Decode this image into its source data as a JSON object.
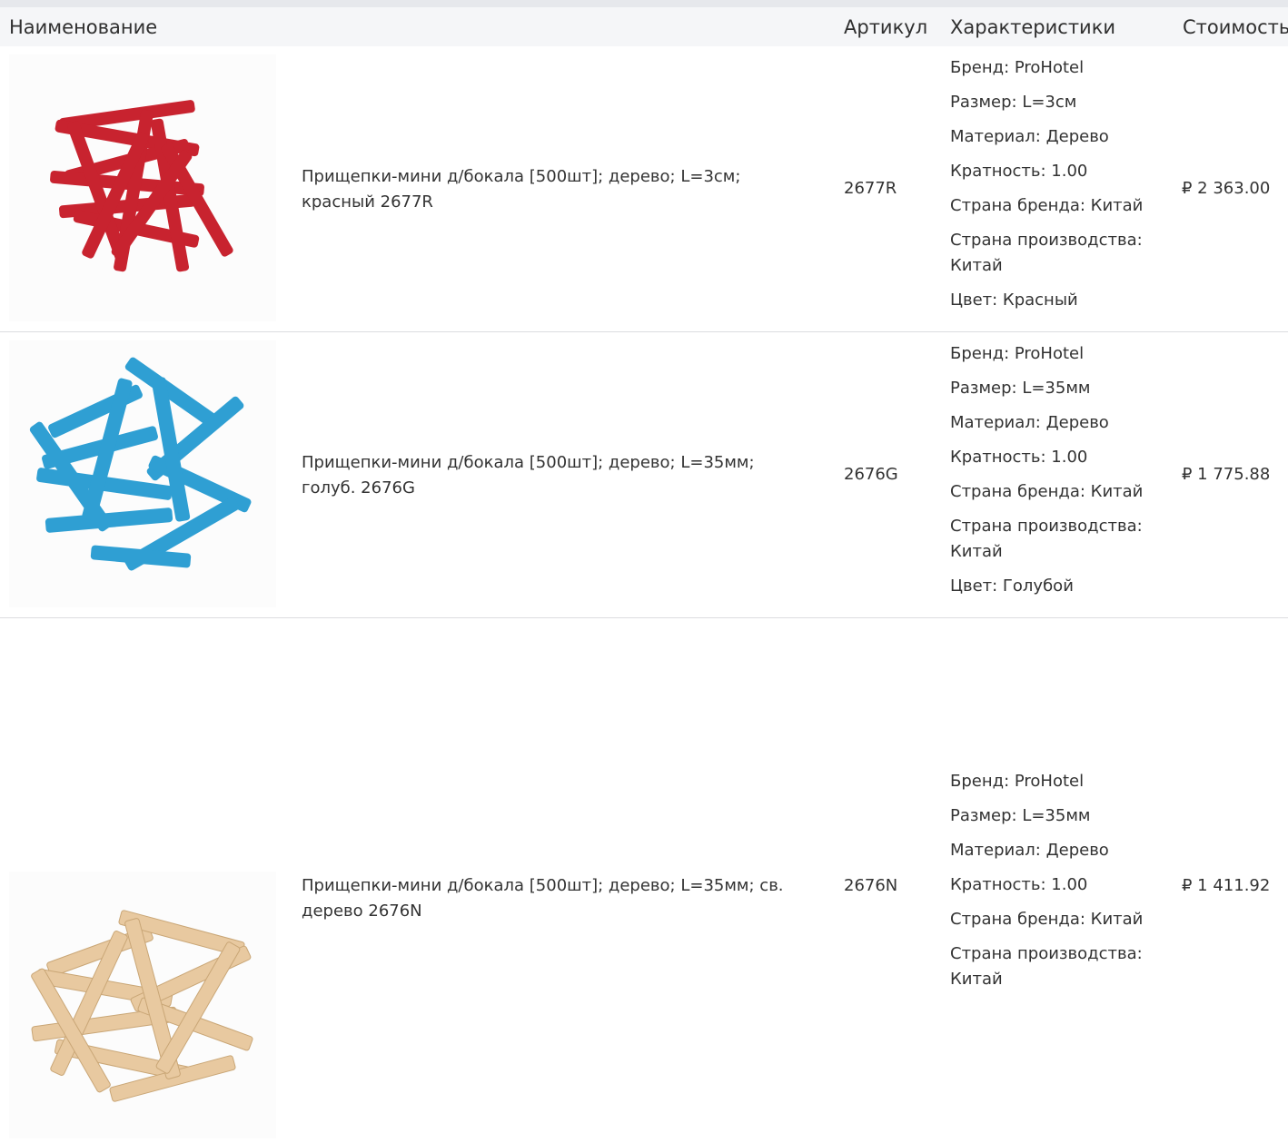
{
  "header": {
    "name": "Наименование",
    "sku": "Артикул",
    "specs": "Характеристики",
    "price": "Стоимость"
  },
  "products": [
    {
      "image_color": "#c8232f",
      "name": "Прищепки-мини д/бокала [500шт]; дерево; L=3см; красный 2677R",
      "sku": "2677R",
      "price": "₽ 2 363.00",
      "specs": [
        "Бренд: ProHotel",
        "Размер: L=3см",
        "Материал: Дерево",
        "Кратность: 1.00",
        "Страна бренда: Китай",
        "Страна производства: Китай",
        "Цвет: Красный"
      ]
    },
    {
      "image_color": "#2f9fd3",
      "name": "Прищепки-мини д/бокала [500шт]; дерево; L=35мм; голуб. 2676G",
      "sku": "2676G",
      "price": "₽ 1 775.88",
      "specs": [
        "Бренд: ProHotel",
        "Размер: L=35мм",
        "Материал: Дерево",
        "Кратность: 1.00",
        "Страна бренда: Китай",
        "Страна производства: Китай",
        "Цвет: Голубой"
      ]
    },
    {
      "image_color": "#e8c9a0",
      "name": "Прищепки-мини д/бокала [500шт]; дерево; L=35мм; св. дерево 2676N",
      "sku": "2676N",
      "price": "₽ 1 411.92",
      "specs": [
        "Бренд: ProHotel",
        "Размер: L=35мм",
        "Материал: Дерево",
        "Кратность: 1.00",
        "Страна бренда: Китай",
        "Страна производства: Китай"
      ]
    }
  ]
}
